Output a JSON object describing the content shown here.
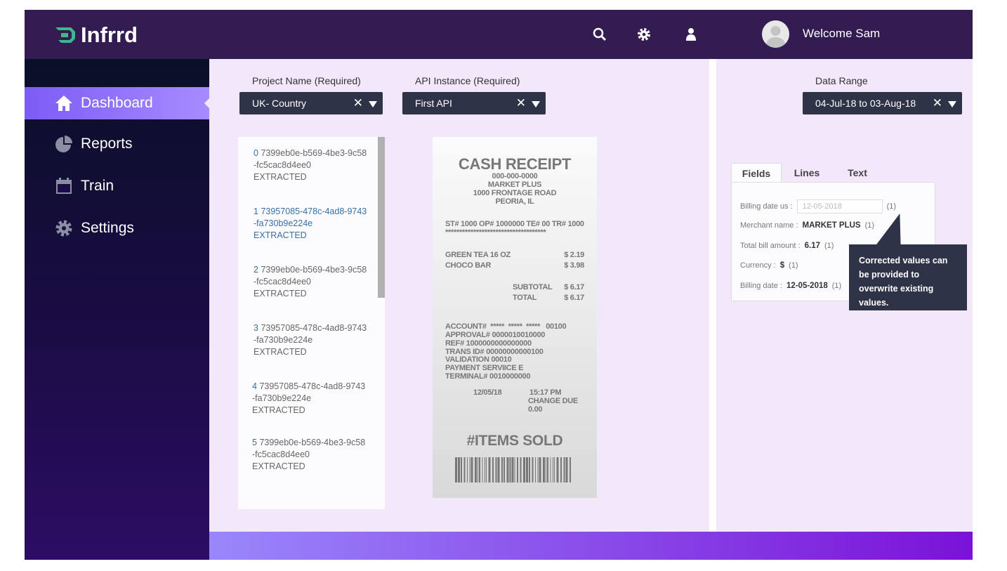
{
  "header": {
    "brand": "Infrrd",
    "welcome": "Welcome Sam",
    "icons": [
      "search-icon",
      "gear-icon",
      "user-icon"
    ]
  },
  "sidebar": {
    "items": [
      {
        "label": "Dashboard",
        "icon": "home-icon",
        "active": true
      },
      {
        "label": "Reports",
        "icon": "pie-chart-icon"
      },
      {
        "label": "Train",
        "icon": "calendar-icon"
      },
      {
        "label": "Settings",
        "icon": "gear-icon"
      }
    ]
  },
  "filters": {
    "project": {
      "label": "Project Name (Required)",
      "value": "UK- Country"
    },
    "api": {
      "label": "API Instance (Required)",
      "value": "First API"
    },
    "range": {
      "label": "Data Range",
      "value": "04-Jul-18 to 03-Aug-18"
    }
  },
  "documents": [
    {
      "index": "0",
      "id1": "7399eb0e-b569-4be3-9c58",
      "id2": "-fc5cac8d4ee0",
      "status": "EXTRACTED"
    },
    {
      "index": "1",
      "id1": "73957085-478c-4ad8-9743",
      "id2": "-fa730b9e224e",
      "status": "EXTRACTED",
      "selected": true
    },
    {
      "index": "2",
      "id1": "7399eb0e-b569-4be3-9c58",
      "id2": "-fc5cac8d4ee0",
      "status": "EXTRACTED"
    },
    {
      "index": "3",
      "id1": "73957085-478c-4ad8-9743",
      "id2": "-fa730b9e224e",
      "status": "EXTRACTED"
    },
    {
      "index": "4",
      "id1": "73957085-478c-4ad8-9743",
      "id2": "-fa730b9e224e",
      "status": "EXTRACTED"
    },
    {
      "index": "5",
      "id1": "7399eb0e-b569-4be3-9c58",
      "id2": "-fc5cac8d4ee0",
      "status": "EXTRACTED"
    }
  ],
  "receipt": {
    "title": "CASH RECEIPT",
    "phone": "000-000-0000",
    "store": "MARKET PLUS",
    "address": "1000 FRONTAGE ROAD",
    "city": "PEORIA, IL",
    "ids": "ST# 1000 OP# 1000000 TE# 00 TR# 1000",
    "stars": "************************************",
    "items": [
      {
        "name": "GREEN TEA 16 OZ",
        "price": "$ 2.19"
      },
      {
        "name": "CHOCO BAR",
        "price": "$ 3.98"
      }
    ],
    "subtotal_label": "SUBTOTAL",
    "subtotal": "$ 6.17",
    "total_label": "TOTAL",
    "total": "$ 6.17",
    "account": "ACCOUNT#  *****  *****  *****   00100",
    "approval": "APPROVAL# 0000010010000",
    "ref": "REF# 1000000000000000",
    "trans": "TRANS ID# 00000000000100",
    "validation": "VALIDATION 00010",
    "payment": "PAYMENT SERVIICE E",
    "terminal": "TERMINAL# 0010000000",
    "date": "12/05/18",
    "time": "15:17 PM",
    "change": "CHANGE DUE 0.00",
    "items_sold": "#ITEMS SOLD"
  },
  "panel": {
    "tabs": [
      "Fields",
      "Lines",
      "Text"
    ],
    "fields": [
      {
        "label": "Billing date us :",
        "value": "12-05-2018",
        "count": "(1)",
        "editable": true
      },
      {
        "label": "Merchant name :",
        "value": "MARKET PLUS",
        "count": "(1)"
      },
      {
        "label": "Total bill amount :",
        "value": "6.17",
        "count": "(1)"
      },
      {
        "label": "Currency :",
        "value": "$",
        "count": "(1)"
      },
      {
        "label": "Billing date :",
        "value": "12-05-2018",
        "count": "(1)"
      }
    ],
    "tooltip": "Corrected values can be provided to overwrite existing values."
  },
  "colors": {
    "header": "#331c52",
    "accent": "#7c5cf6",
    "brand_logo": "#3fb68b",
    "select_bg": "#2f3347"
  }
}
